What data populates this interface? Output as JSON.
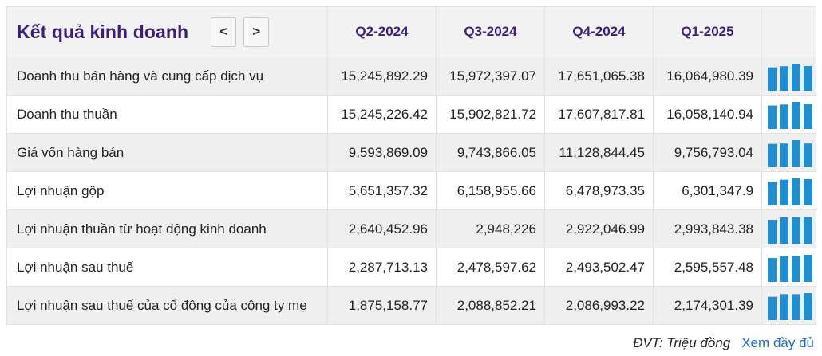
{
  "title": "Kết quả kinh doanh",
  "nav": {
    "prev_label": "<",
    "next_label": ">"
  },
  "columns": [
    "Q2-2024",
    "Q3-2024",
    "Q4-2024",
    "Q1-2025"
  ],
  "rows": [
    {
      "label": "Doanh thu bán hàng và cung cấp dịch vụ",
      "values": [
        "15,245,892.29",
        "15,972,397.07",
        "17,651,065.38",
        "16,064,980.39"
      ]
    },
    {
      "label": "Doanh thu thuần",
      "values": [
        "15,245,226.42",
        "15,902,821.72",
        "17,607,817.81",
        "16,058,140.94"
      ]
    },
    {
      "label": "Giá vốn hàng bán",
      "values": [
        "9,593,869.09",
        "9,743,866.05",
        "11,128,844.45",
        "9,756,793.04"
      ]
    },
    {
      "label": "Lợi nhuận gộp",
      "values": [
        "5,651,357.32",
        "6,158,955.66",
        "6,478,973.35",
        "6,301,347.9"
      ]
    },
    {
      "label": "Lợi nhuận thuần từ hoạt động kinh doanh",
      "values": [
        "2,640,452.96",
        "2,948,226",
        "2,922,046.99",
        "2,993,843.38"
      ]
    },
    {
      "label": "Lợi nhuận sau thuế",
      "values": [
        "2,287,713.13",
        "2,478,597.62",
        "2,493,502.47",
        "2,595,557.48"
      ]
    },
    {
      "label": "Lợi nhuận sau thuế của cổ đông của công ty mẹ",
      "values": [
        "1,875,158.77",
        "2,088,852.21",
        "2,086,993.22",
        "2,174,301.39"
      ]
    }
  ],
  "spark_color": "#1f8fd1",
  "footer": {
    "unit": "ĐVT: Triệu đồng",
    "more_link": "Xem đầy đủ"
  }
}
